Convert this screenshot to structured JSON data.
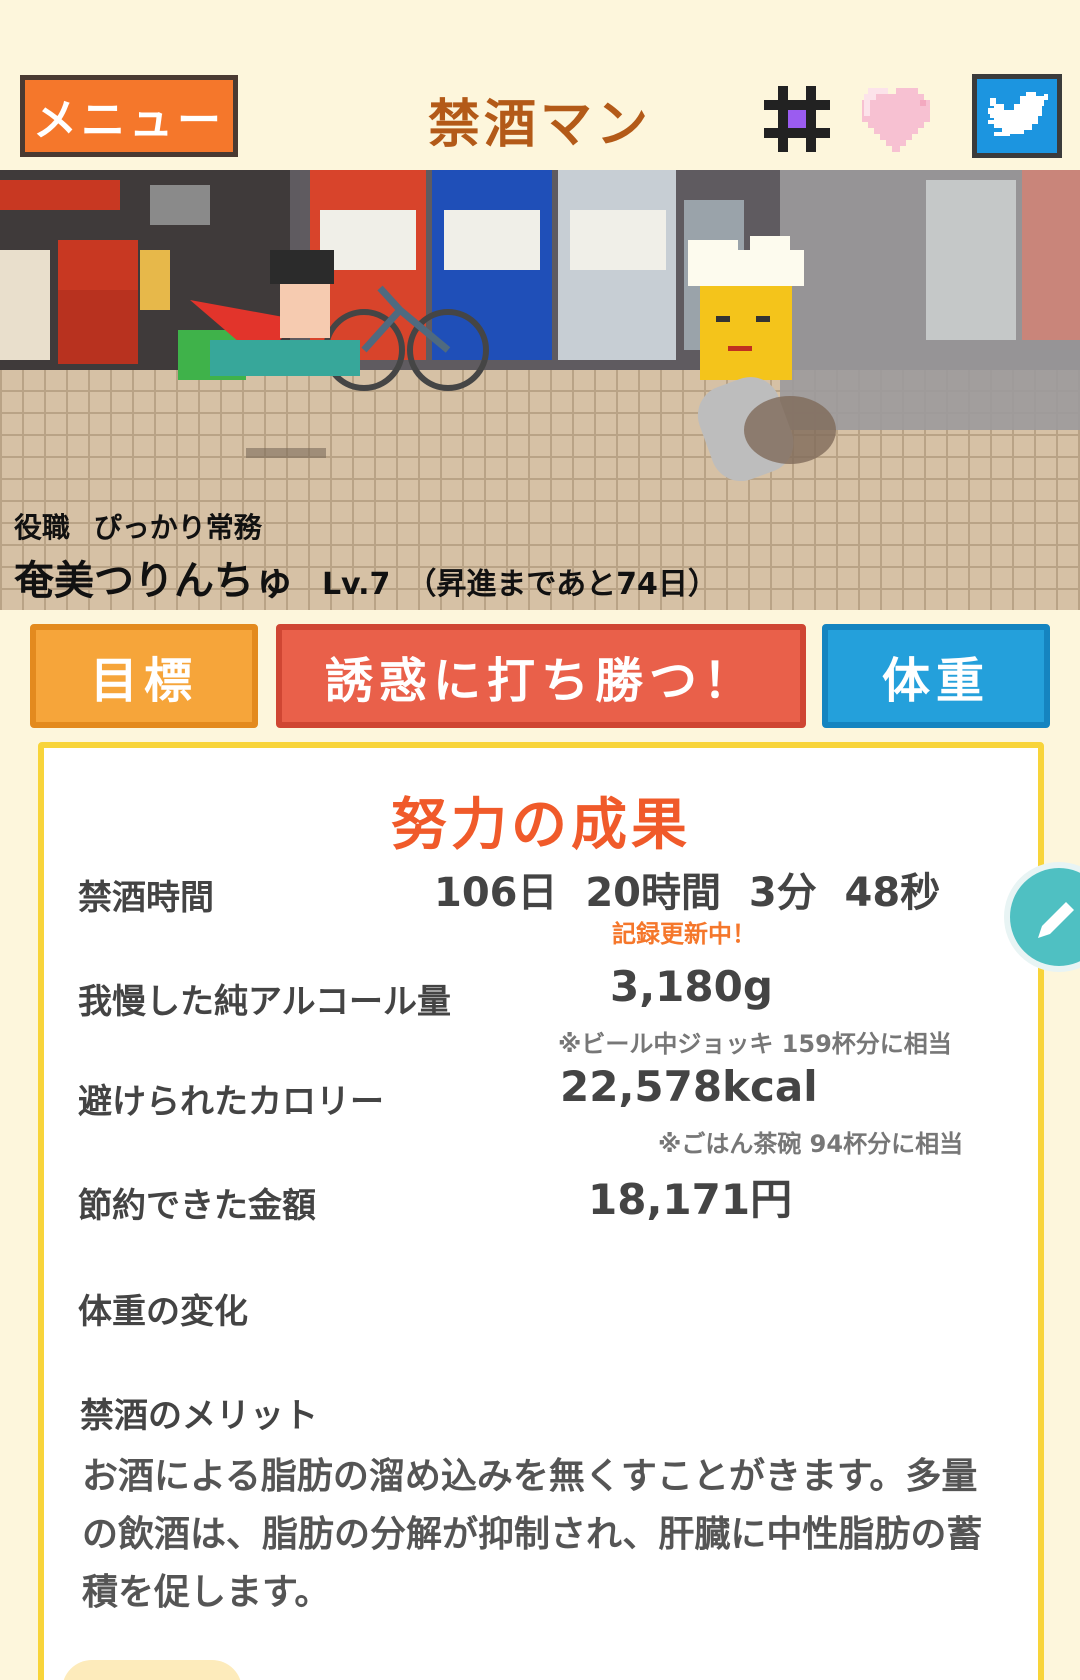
{
  "header": {
    "menu_label": "メニュー",
    "title": "禁酒マン",
    "icons": [
      "hash-icon",
      "heart-icon",
      "twitter-icon"
    ]
  },
  "character": {
    "role_label": "役職",
    "role": "ぴっかり常務",
    "name": "奄美つりんちゅ",
    "level": "Lv.7",
    "promotion": "（昇進まであと74日）"
  },
  "actions": {
    "goal_label": "目標",
    "win_label": "誘惑に打ち勝つ！",
    "weight_label": "体重"
  },
  "results": {
    "title": "努力の成果",
    "abstinence_label": "禁酒時間",
    "abstinence_value": "106日  20時間  3分  48秒",
    "record_note": "記録更新中！",
    "alcohol_label": "我慢した純アルコール量",
    "alcohol_value": "3,180g",
    "alcohol_note": "※ビール中ジョッキ 159杯分に相当",
    "calorie_label": "避けられたカロリー",
    "calorie_value": "22,578kcal",
    "calorie_note": "※ごはん茶碗 94杯分に相当",
    "money_label": "節約できた金額",
    "money_value": "18,171円",
    "weight_label": "体重の変化",
    "merit_label": "禁酒のメリット",
    "merit_text": "お酒による脂肪の溜め込みを無くすことがきます。多量の飲酒は、脂肪の分解が抑制され、肝臓に中性脂肪の蓄積を促します。"
  },
  "colors": {
    "background": "#fdf6dc",
    "menu": "#f5772b",
    "title": "#b35a18",
    "goal": "#f6a53a",
    "win": "#e9604a",
    "weight": "#24a0db",
    "card_border": "#f8d43a",
    "card_title": "#f05a2a"
  }
}
